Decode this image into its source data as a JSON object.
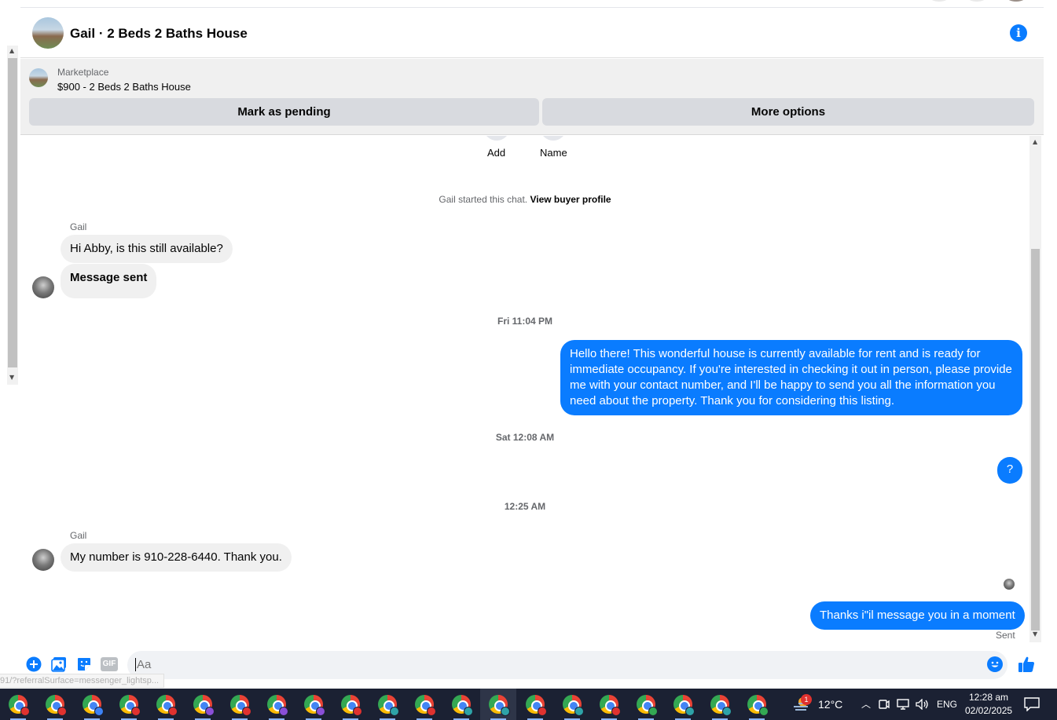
{
  "header": {
    "title": "Gail · 2 Beds 2 Baths House",
    "info_icon": "info-icon",
    "info_glyph": "i",
    "accent": "#0a7cff"
  },
  "marketplace": {
    "label": "Marketplace",
    "listing": "$900 - 2 Beds 2 Baths House",
    "pending_button": "Mark as pending",
    "options_button": "More options"
  },
  "chat": {
    "top_actions": [
      {
        "label": "Add"
      },
      {
        "label": "Name"
      }
    ],
    "started_text": "Gail started this chat.",
    "buyer_profile_link": "View buyer profile",
    "messages": [
      {
        "sender": "Gail",
        "text": "Hi Abby, is this still available?"
      },
      {
        "text": "Message sent"
      },
      {
        "timestamp": "Fri 11:04 PM"
      },
      {
        "text": "Hello there! This wonderful house is currently available for rent and is ready for immediate occupancy. If you're interested in checking it out in person, please provide me with your contact number, and I'll be happy to send you all the information you need about the property. Thank you for considering this listing."
      },
      {
        "timestamp": "Sat 12:08 AM"
      },
      {
        "text": "?"
      },
      {
        "timestamp": "12:25 AM"
      },
      {
        "sender": "Gail",
        "text": "My number is 910-228-6440.  Thank you."
      },
      {
        "text": "Thanks i\"il message you in a moment",
        "status": "Sent"
      }
    ]
  },
  "composer": {
    "placeholder": "Aa",
    "icons": [
      "plus-icon",
      "photo-icon",
      "sticker-icon",
      "gif-icon",
      "emoji-icon",
      "like-icon"
    ],
    "gif_label": "GIF"
  },
  "status_bar": {
    "url": "91/?referralSurface=messenger_lightsp..."
  },
  "taskbar": {
    "weather": "12°C",
    "weather_badge": "1",
    "language": "ENG",
    "time": "12:28 am",
    "date": "02/02/2025",
    "browser_icon_count": 21
  }
}
